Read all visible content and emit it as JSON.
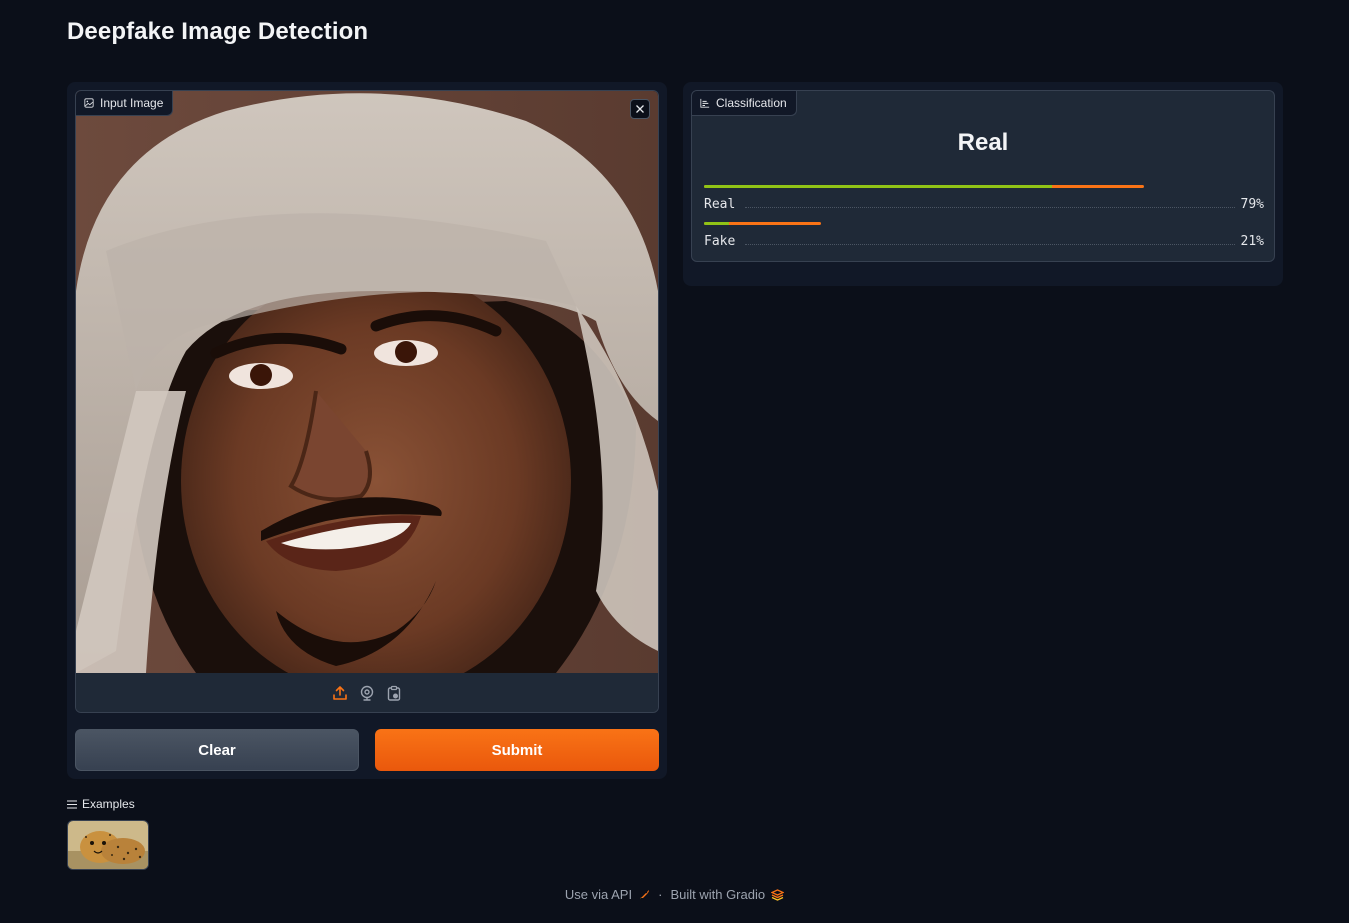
{
  "page": {
    "title": "Deepfake Image Detection"
  },
  "input_image": {
    "label": "Input Image",
    "label_icon": "image-icon",
    "close_icon": "close-icon",
    "sources": [
      {
        "name": "upload-icon",
        "color": "#f97316"
      },
      {
        "name": "webcam-icon",
        "color": "#9ca3af"
      },
      {
        "name": "clipboard-icon",
        "color": "#9ca3af"
      }
    ]
  },
  "buttons": {
    "clear_label": "Clear",
    "submit_label": "Submit"
  },
  "classification": {
    "label": "Classification",
    "label_icon": "bar-chart-icon",
    "top_label": "Real",
    "confidences": [
      {
        "label": "Real",
        "value": 0.79,
        "display": "79%"
      },
      {
        "label": "Fake",
        "value": 0.21,
        "display": "21%"
      }
    ]
  },
  "examples": {
    "label": "Examples",
    "icon": "list-icon",
    "items": [
      {
        "name": "cheetah-example"
      }
    ]
  },
  "footer": {
    "api_label": "Use via API",
    "separator": "·",
    "built_label": "Built with Gradio"
  },
  "colors": {
    "background": "#0b0f19",
    "accent": "#f97316",
    "confidence_green": "#84cc16"
  }
}
